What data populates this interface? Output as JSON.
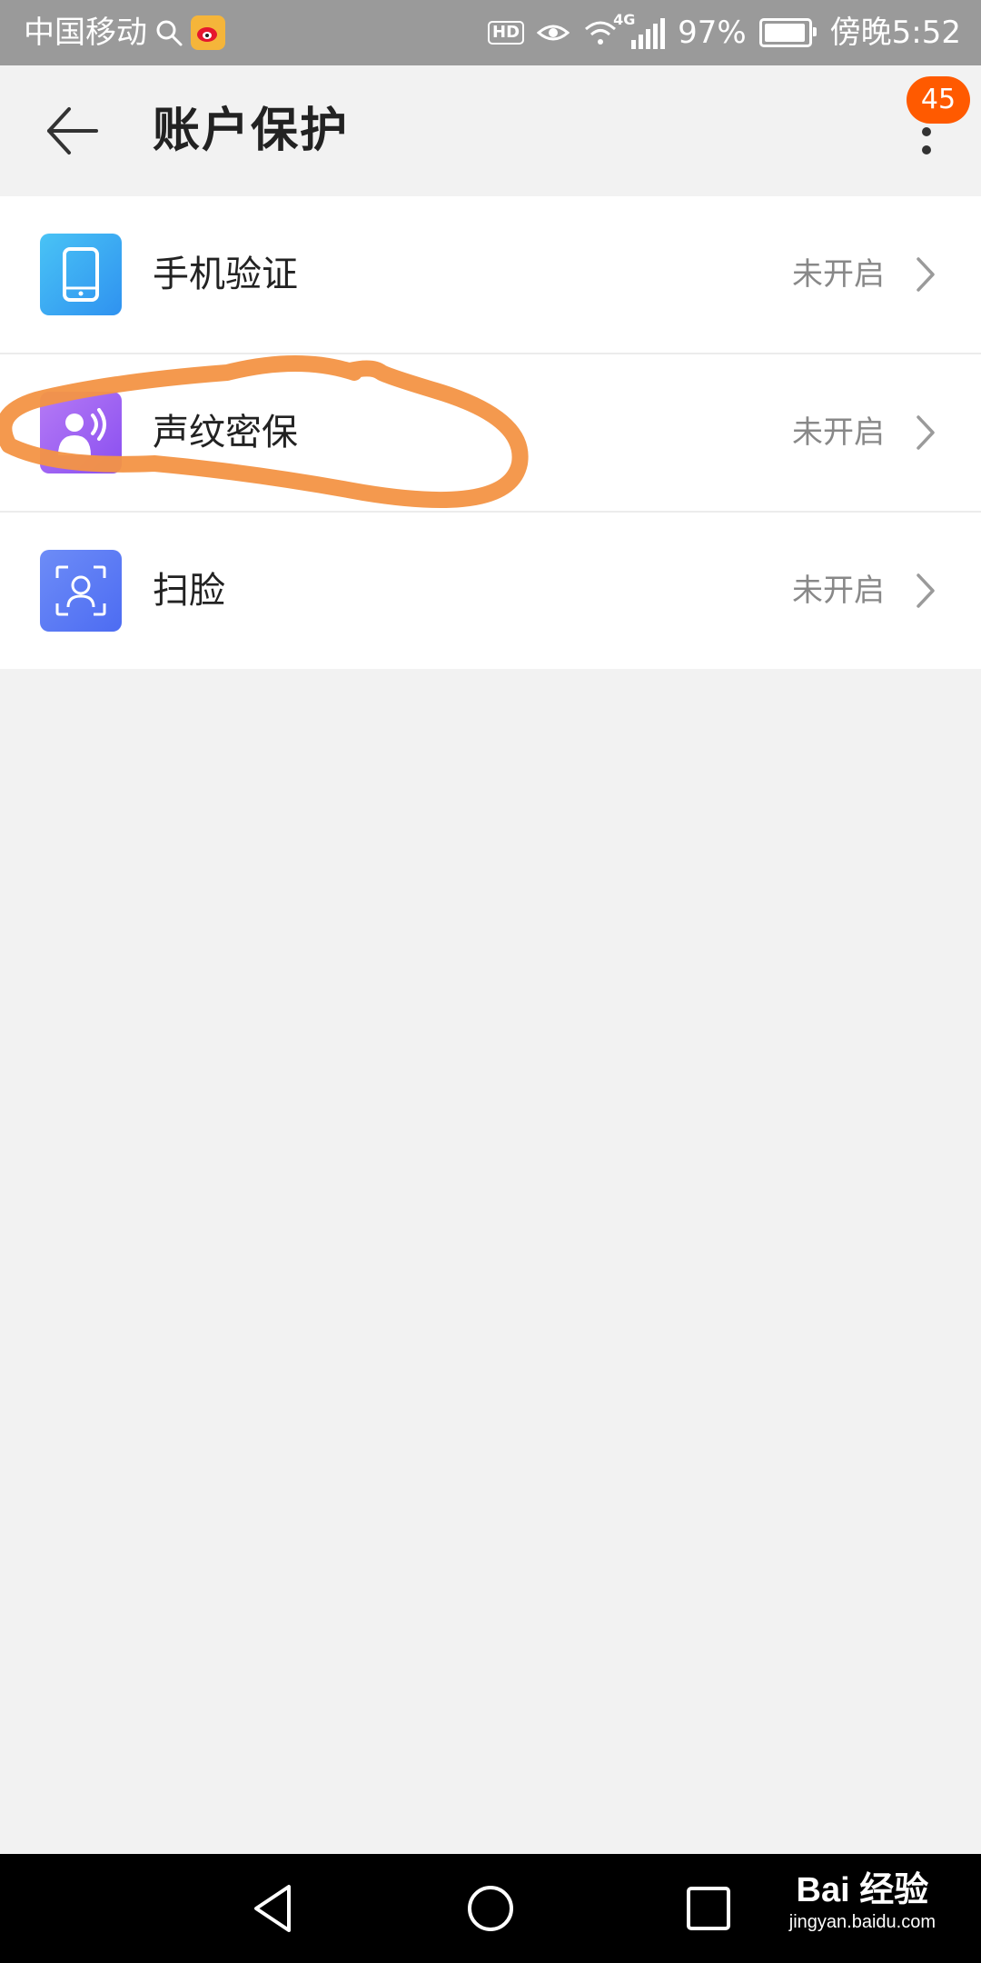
{
  "status_bar": {
    "carrier": "中国移动",
    "hd": "HD",
    "network": "4G",
    "battery_percent": "97%",
    "time": "傍晚5:52",
    "battery_level": 0.97
  },
  "header": {
    "title": "账户保护",
    "badge_count": "45"
  },
  "items": [
    {
      "label": "手机验证",
      "status": "未开启",
      "icon": "phone-icon",
      "color": "#3aa8f5"
    },
    {
      "label": "声纹密保",
      "status": "未开启",
      "icon": "voiceprint-icon",
      "color": "#a15cf0"
    },
    {
      "label": "扫脸",
      "status": "未开启",
      "icon": "face-scan-icon",
      "color": "#5b7df5"
    }
  ],
  "watermark": {
    "main": "Bai 经验",
    "sub": "jingyan.baidu.com"
  },
  "colors": {
    "accent_badge": "#ff5a00",
    "annotation": "#f39445"
  }
}
